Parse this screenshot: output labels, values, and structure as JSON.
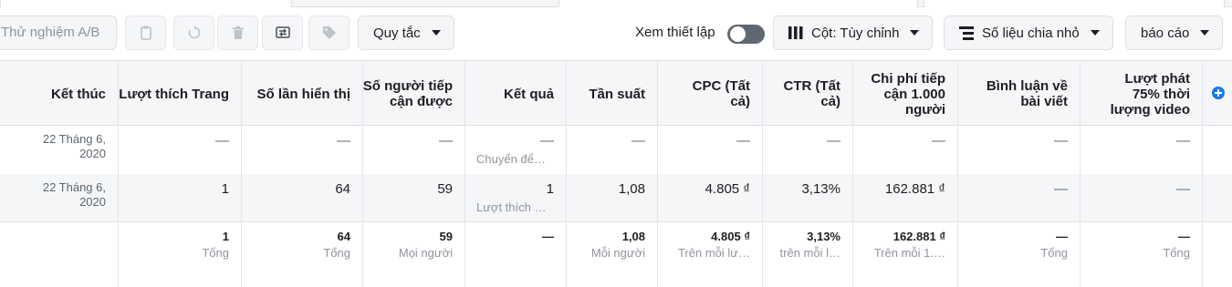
{
  "toolbar": {
    "ab_test_label": "Thử nghiệm A/B",
    "rules_label": "Quy tắc",
    "view_settings_label": "Xem thiết lập",
    "columns_label": "Cột: Tùy chỉnh",
    "breakdown_label": "Số liệu chia nhỏ",
    "reports_label": "báo cáo",
    "icon_buttons": [
      "clipboard-icon",
      "reset-icon",
      "trash-icon",
      "switch-icon",
      "tag-icon"
    ],
    "view_settings_toggle": "off"
  },
  "table": {
    "headers": {
      "end": "Kết thúc",
      "page_likes": "Lượt thích Trang",
      "impressions": "Số lần hiển thị",
      "reach": "Số người tiếp cận được",
      "results": "Kết quả",
      "frequency": "Tần suất",
      "cpc": "CPC (Tất cả)",
      "ctr": "CTR (Tất cả)",
      "cpm": "Chi phí tiếp cận 1.000 người",
      "post_comments": "Bình luận về bài viết",
      "video_75": "Lượt phát 75% thời lượng video"
    },
    "rows": [
      {
        "end": "22 Tháng 6, 2020",
        "page_likes": "—",
        "impressions": "—",
        "reach": "—",
        "results": "—",
        "results_sub": "Chuyển để…",
        "frequency": "—",
        "cpc": "—",
        "ctr": "—",
        "cpm": "—",
        "post_comments": "—",
        "video_75": "—"
      },
      {
        "end": "22 Tháng 6, 2020",
        "page_likes": "1",
        "impressions": "64",
        "reach": "59",
        "results": "1",
        "results_sub": "Lượt thích …",
        "frequency": "1,08",
        "cpc": "4.805 ₫",
        "ctr": "3,13%",
        "cpm": "162.881 ₫",
        "post_comments": "—",
        "video_75": "—"
      }
    ],
    "totals": {
      "page_likes": "1",
      "page_likes_sub": "Tổng",
      "impressions": "64",
      "impressions_sub": "Tổng",
      "reach": "59",
      "reach_sub": "Mọi người",
      "results": "—",
      "frequency": "1,08",
      "frequency_sub": "Mỗi người",
      "cpc": "4.805 ₫",
      "cpc_sub": "Trên mỗi lư…",
      "ctr": "3,13%",
      "ctr_sub": "trên mỗi l…",
      "cpm": "162.881 ₫",
      "cpm_sub": "Trên mỗi 1.…",
      "post_comments": "—",
      "post_comments_sub": "Tổng",
      "video_75": "—",
      "video_75_sub": "Tổng"
    }
  },
  "colors": {
    "header_bg": "#f5f6f7",
    "border": "#dddfe2",
    "secondary_text": "#90949c",
    "accent": "#1877f2",
    "toggle_off": "#606770"
  }
}
